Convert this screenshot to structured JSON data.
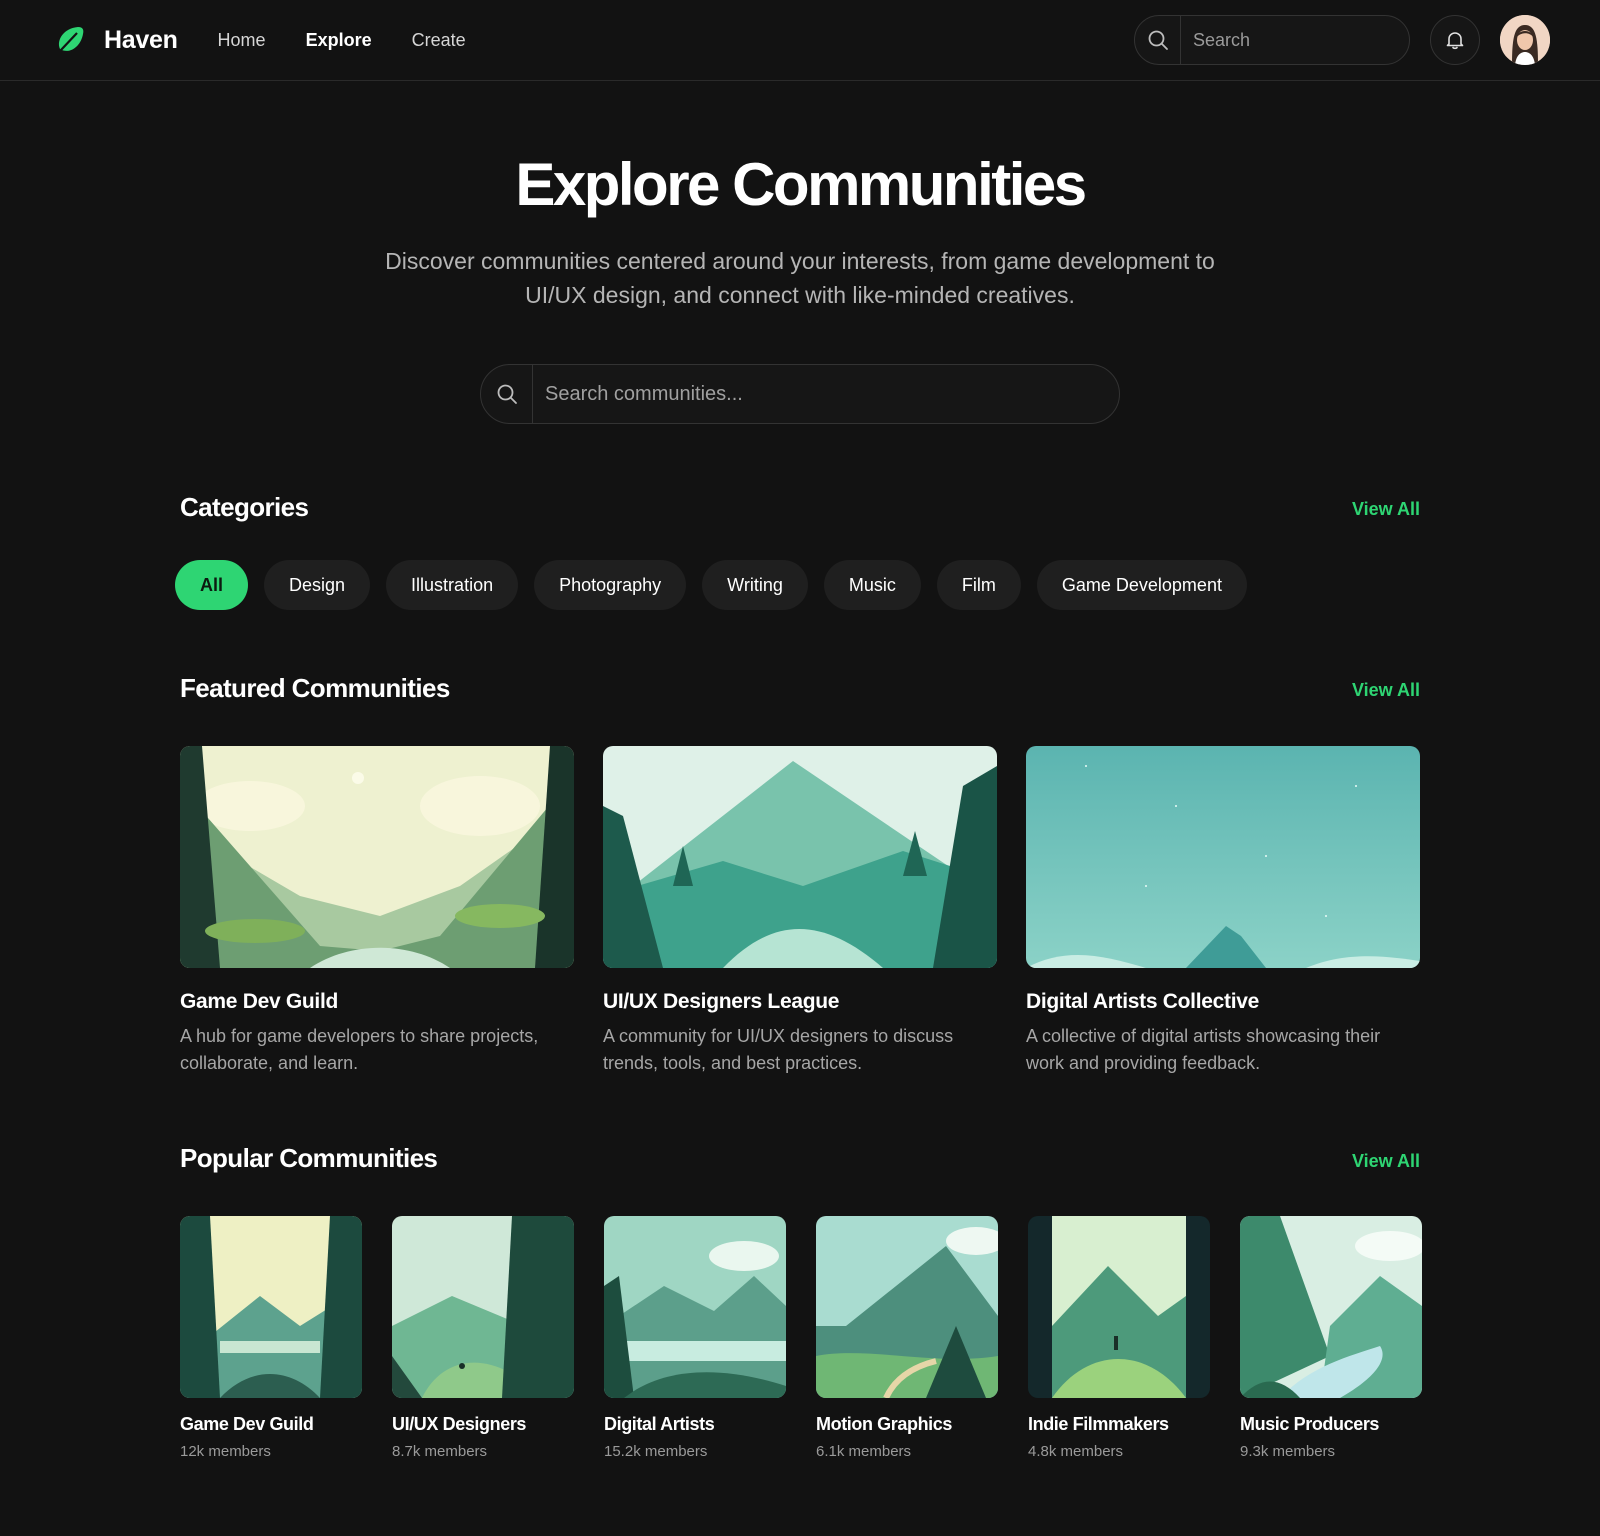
{
  "nav": {
    "brand": "Haven",
    "links": [
      "Home",
      "Explore",
      "Create"
    ],
    "active_link": "Explore",
    "search_placeholder": "Search"
  },
  "hero": {
    "title": "Explore Communities",
    "subtitle": "Discover communities centered around your interests, from game development to UI/UX design, and connect with like-minded creatives.",
    "search_placeholder": "Search communities..."
  },
  "categories": {
    "title": "Categories",
    "view_all": "View All",
    "chips": [
      "All",
      "Design",
      "Illustration",
      "Photography",
      "Writing",
      "Music",
      "Film",
      "Game Development"
    ],
    "active": "All"
  },
  "featured": {
    "title": "Featured Communities",
    "view_all": "View All",
    "cards": [
      {
        "name": "Game Dev Guild",
        "description": "A hub for game developers to share projects, collaborate, and learn."
      },
      {
        "name": "UI/UX Designers League",
        "description": "A community for UI/UX designers to discuss trends, tools, and best practices."
      },
      {
        "name": "Digital Artists Collective",
        "description": "A collective of digital artists showcasing their work and providing feedback."
      }
    ]
  },
  "popular": {
    "title": "Popular Communities",
    "view_all": "View All",
    "cards": [
      {
        "name": "Game Dev Guild",
        "members": "12k members"
      },
      {
        "name": "UI/UX Designers",
        "members": "8.7k members"
      },
      {
        "name": "Digital Artists",
        "members": "15.2k members"
      },
      {
        "name": "Motion Graphics",
        "members": "6.1k members"
      },
      {
        "name": "Indie Filmmakers",
        "members": "4.8k members"
      },
      {
        "name": "Music Producers",
        "members": "9.3k members"
      }
    ]
  },
  "colors": {
    "background": "#121212",
    "accent": "#2ed573",
    "chip": "#1f1f1f",
    "muted_text": "#a6a6a6"
  },
  "icons": [
    "leaf-logo-icon",
    "search-icon",
    "bell-icon",
    "avatar"
  ]
}
